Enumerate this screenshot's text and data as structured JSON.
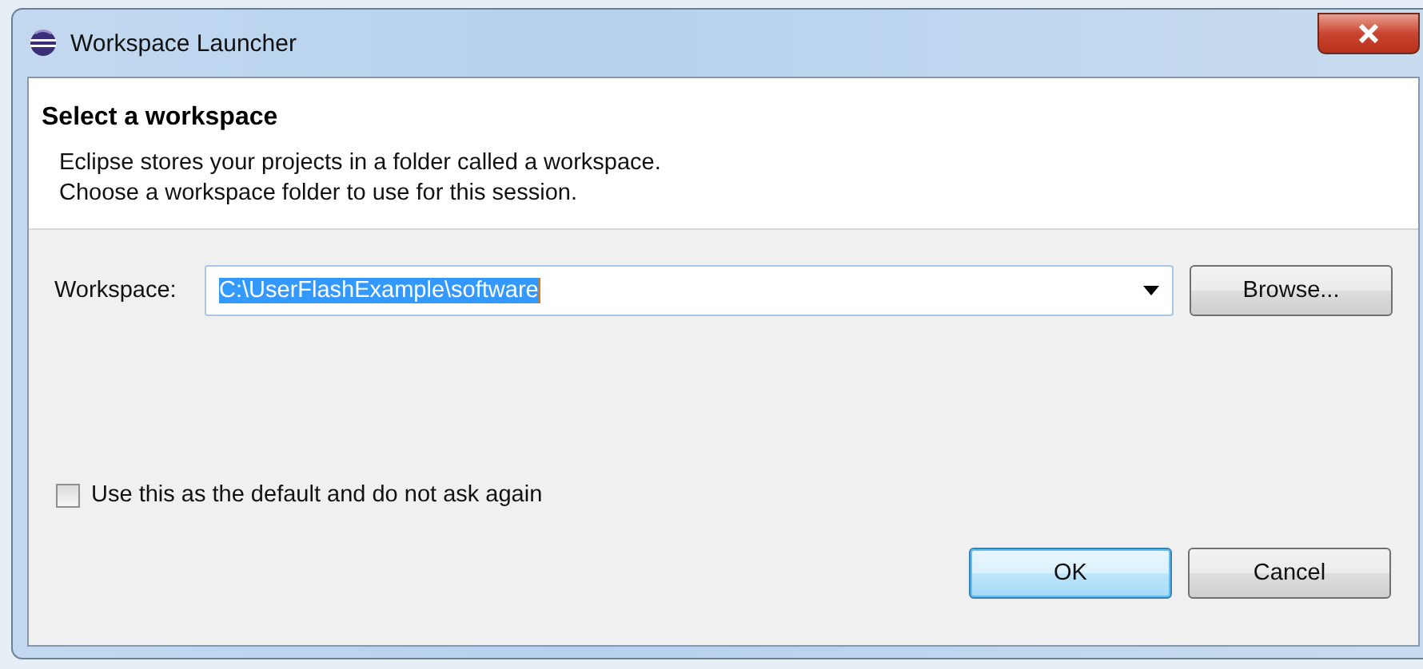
{
  "window": {
    "title": "Workspace Launcher"
  },
  "header": {
    "title": "Select a workspace",
    "lines": [
      "Eclipse stores your projects in a folder called a workspace.",
      "Choose a workspace folder to use for this session."
    ]
  },
  "workspace": {
    "label": "Workspace:",
    "value": "C:\\UserFlashExample\\software",
    "selected": true
  },
  "browse_button": {
    "label": "Browse..."
  },
  "remember": {
    "label": "Use this as the default and do not ask again",
    "checked": false
  },
  "buttons": [
    {
      "label": "OK",
      "default": true
    },
    {
      "label": "Cancel",
      "default": false
    }
  ]
}
